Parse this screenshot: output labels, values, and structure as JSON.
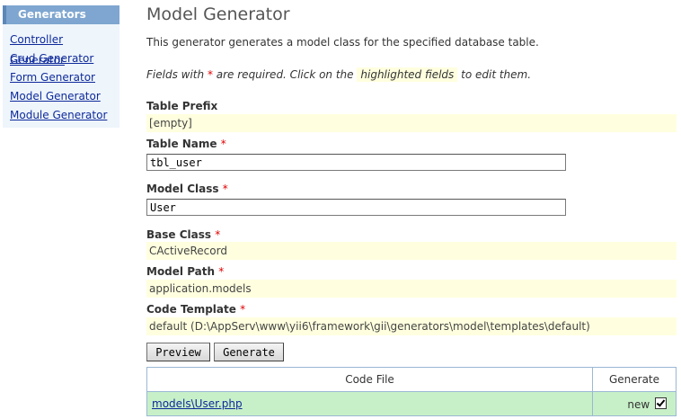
{
  "sidebar": {
    "title": "Generators",
    "items": [
      {
        "label": "Controller Generator"
      },
      {
        "label": "Crud Generator"
      },
      {
        "label": "Form Generator"
      },
      {
        "label": "Model Generator"
      },
      {
        "label": "Module Generator"
      }
    ]
  },
  "main": {
    "title": "Model Generator",
    "description": "This generator generates a model class for the specified database table.",
    "hint": {
      "part1": "Fields with",
      "required_mark": "*",
      "part2": "are required. Click on the",
      "highlight": "highlighted fields",
      "part3": "to edit them."
    }
  },
  "form": {
    "table_prefix": {
      "label": "Table Prefix",
      "value": "[empty]"
    },
    "table_name": {
      "label": "Table Name",
      "value": "tbl_user"
    },
    "model_class": {
      "label": "Model Class",
      "value": "User"
    },
    "base_class": {
      "label": "Base Class",
      "value": "CActiveRecord"
    },
    "model_path": {
      "label": "Model Path",
      "value": "application.models"
    },
    "code_template": {
      "label": "Code Template",
      "value": "default (D:\\AppServ\\www\\yii6\\framework\\gii\\generators\\model\\templates\\default)"
    },
    "required_mark": "*"
  },
  "buttons": {
    "preview": "Preview",
    "generate": "Generate"
  },
  "table": {
    "headers": {
      "code_file": "Code File",
      "generate": "Generate"
    },
    "rows": [
      {
        "file": "models\\User.php",
        "status": "new",
        "checked": true
      }
    ]
  }
}
